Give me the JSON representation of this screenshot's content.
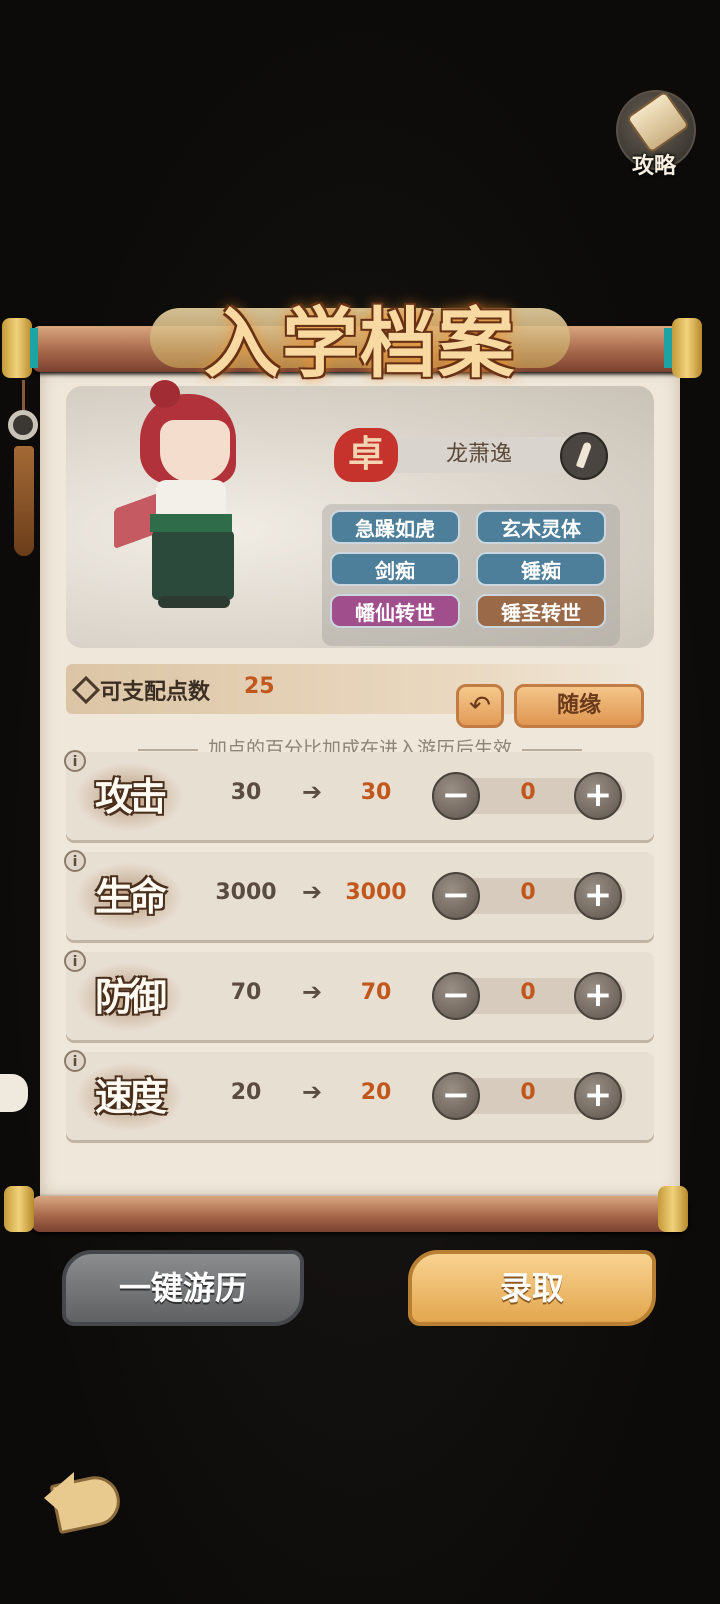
{
  "guide": {
    "label": "攻略",
    "icon": "scroll-icon"
  },
  "title": "入学档案",
  "character": {
    "seal": "卓",
    "name": "龙萧逸",
    "traits": [
      {
        "label": "急躁如虎",
        "color": "blue"
      },
      {
        "label": "玄木灵体",
        "color": "blue"
      },
      {
        "label": "剑痴",
        "color": "blue"
      },
      {
        "label": "锤痴",
        "color": "blue"
      },
      {
        "label": "幡仙转世",
        "color": "pink"
      },
      {
        "label": "锤圣转世",
        "color": "brown"
      }
    ]
  },
  "points": {
    "label": "可支配点数",
    "value": "25",
    "random_label": "随缘",
    "reset_icon": "undo-icon"
  },
  "hint": "加点的百分比加成在进入游历后生效",
  "stats": [
    {
      "label": "攻击",
      "base": "30",
      "new": "30",
      "added": "0"
    },
    {
      "label": "生命",
      "base": "3000",
      "new": "3000",
      "added": "0"
    },
    {
      "label": "防御",
      "base": "70",
      "new": "70",
      "added": "0"
    },
    {
      "label": "速度",
      "base": "20",
      "new": "20",
      "added": "0"
    }
  ],
  "stat_info_glyph": "i",
  "arrow_glyph": "➔",
  "minus_glyph": "−",
  "plus_glyph": "+",
  "buttons": {
    "tour": "一键游历",
    "admit": "录取"
  },
  "colors": {
    "accent_orange": "#c2571e",
    "trait_blue": "#4e7f9a",
    "trait_pink": "#a04e8c",
    "trait_brown": "#9a6a48",
    "seal_red": "#c6332c"
  }
}
